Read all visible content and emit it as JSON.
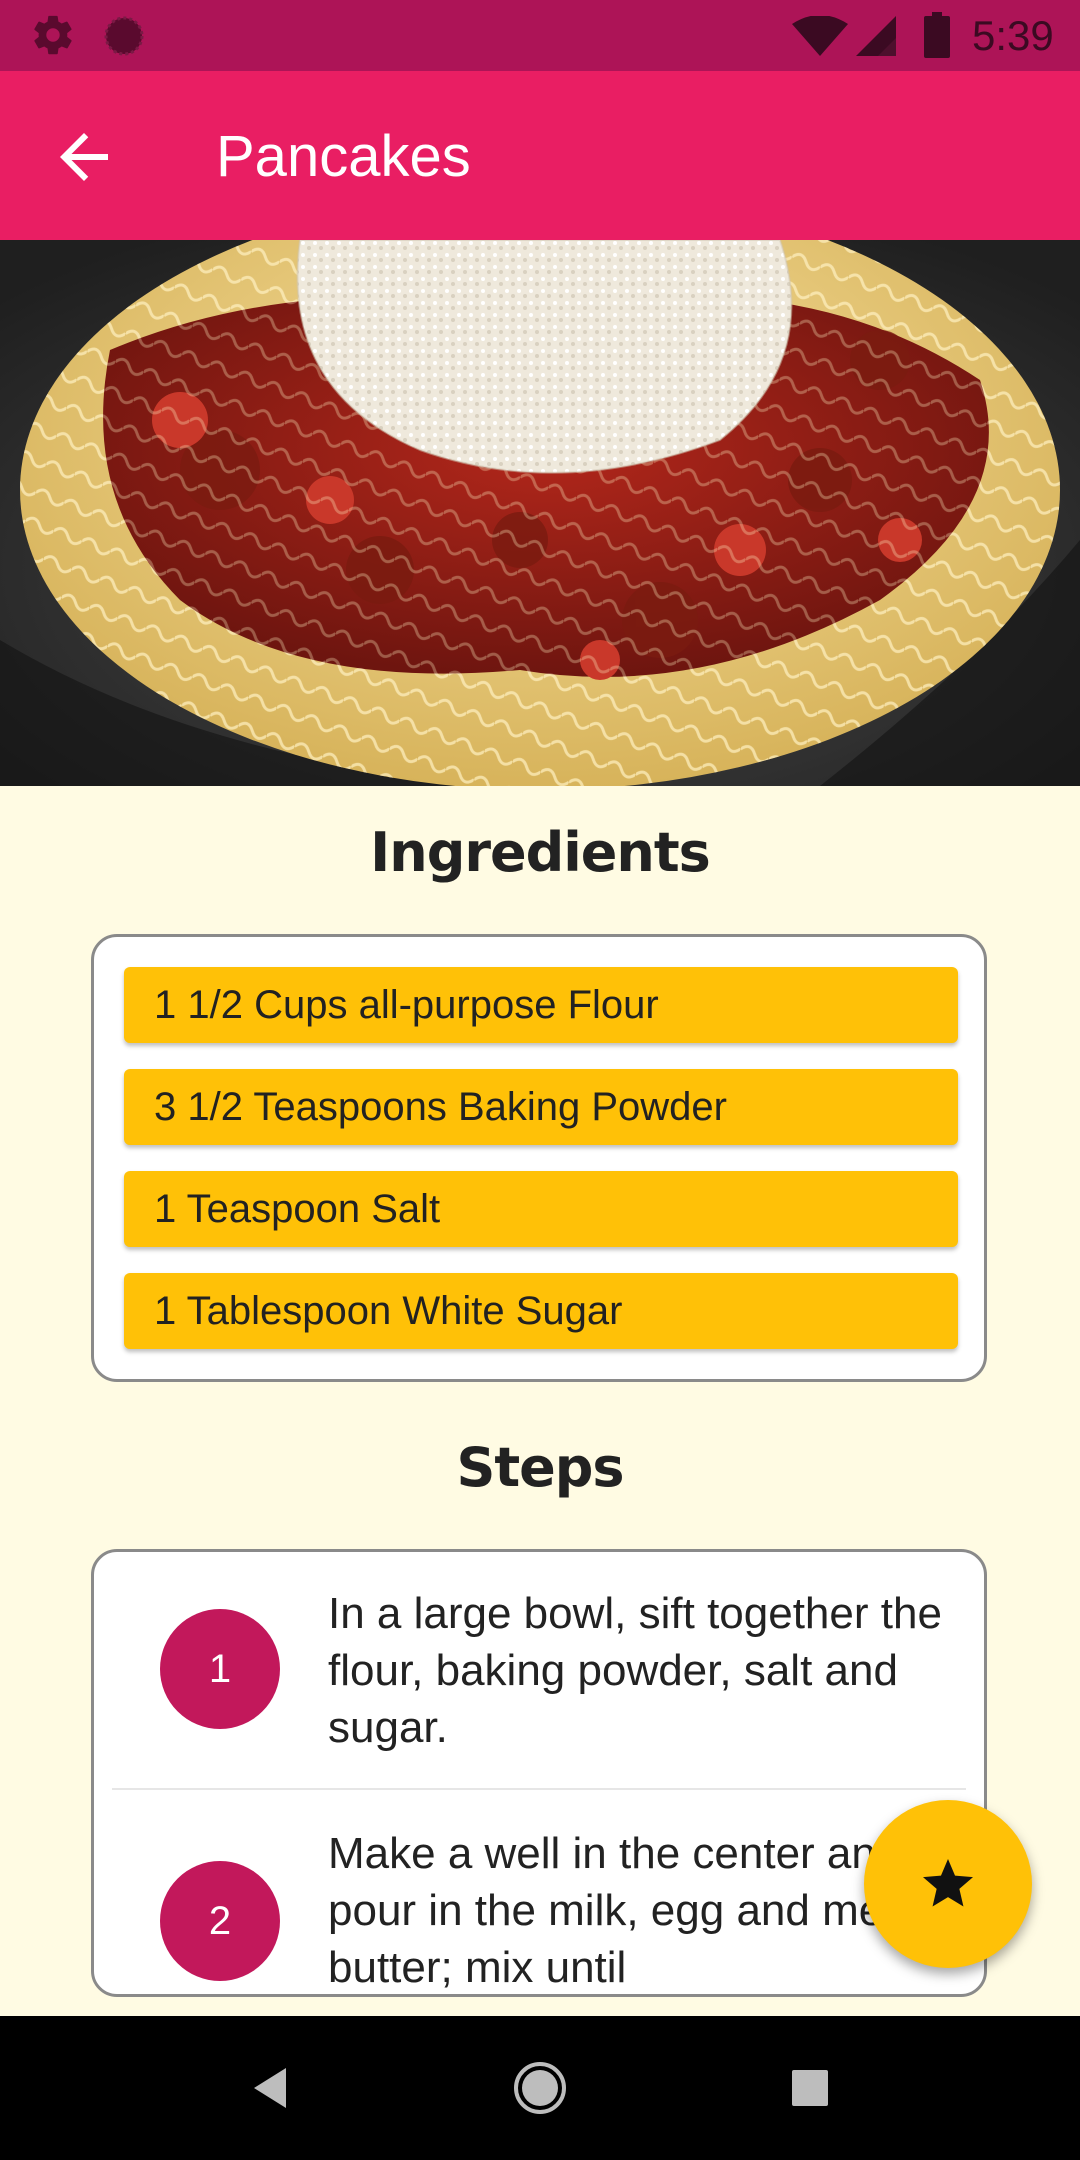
{
  "status_bar": {
    "time": "5:39",
    "icons": [
      "gear-icon",
      "circle-notification-icon",
      "wifi-icon",
      "signal-icon",
      "battery-icon"
    ]
  },
  "app_bar": {
    "title": "Pancakes",
    "back_icon": "arrow-back-icon",
    "color": "#e91e63"
  },
  "hero": {
    "image": "spaghetti-bolognese-photo"
  },
  "ingredients": {
    "heading": "Ingredients",
    "items": [
      "1 1/2 Cups all-purpose Flour",
      "3 1/2 Teaspoons Baking Powder",
      "1 Teaspoon Salt",
      "1 Tablespoon White Sugar"
    ]
  },
  "steps": {
    "heading": "Steps",
    "items": [
      {
        "number": "1",
        "text": "In a large bowl, sift together the flour, baking powder, salt and sugar."
      },
      {
        "number": "2",
        "text": "Make a well in the center and pour in the milk, egg and melted butter; mix until"
      }
    ]
  },
  "fab": {
    "icon": "star-icon",
    "color": "#ffc107"
  },
  "nav_bar": {
    "icons": [
      "back-triangle-icon",
      "home-circle-icon",
      "recents-square-icon"
    ]
  },
  "colors": {
    "accent": "#ffc107",
    "primary": "#e91e63",
    "primary_dark": "#ad1457",
    "step_circle": "#c2185b",
    "background": "#fffbe3"
  }
}
